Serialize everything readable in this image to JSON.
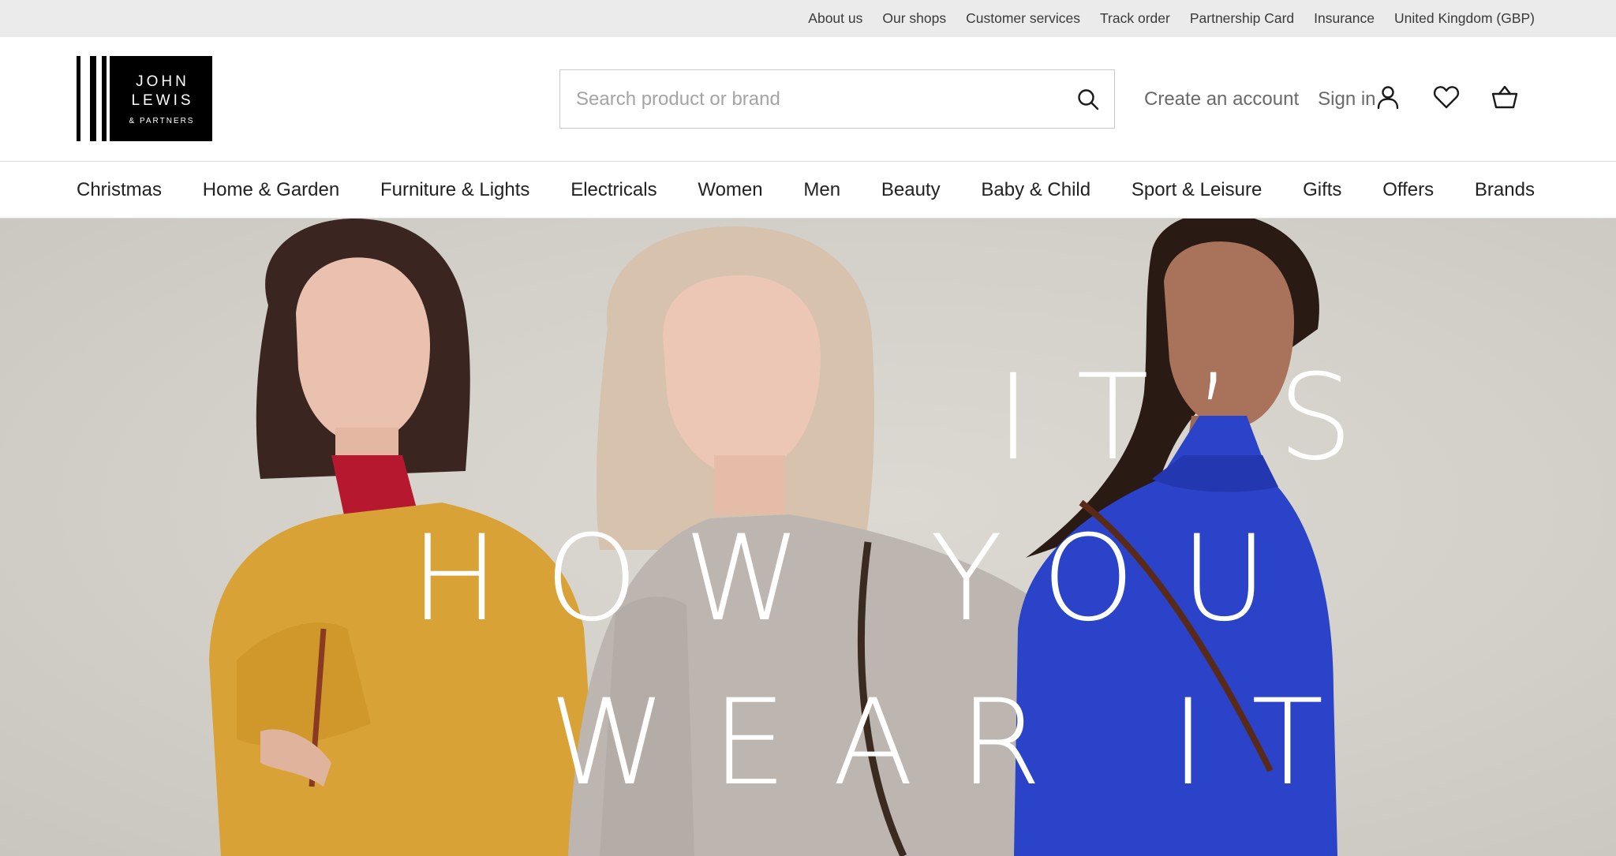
{
  "utility_nav": {
    "links": [
      "About us",
      "Our shops",
      "Customer services",
      "Track order",
      "Partnership Card",
      "Insurance",
      "United Kingdom (GBP)"
    ]
  },
  "logo": {
    "line1": "JOHN",
    "line2": "LEWIS",
    "line3": "& PARTNERS"
  },
  "search": {
    "placeholder": "Search product or brand",
    "icon": "search-icon"
  },
  "account": {
    "create_account": "Create an account",
    "sign_in": "Sign in",
    "icons": [
      "user-icon",
      "heart-icon",
      "basket-icon"
    ]
  },
  "main_nav": {
    "items": [
      "Christmas",
      "Home & Garden",
      "Furniture & Lights",
      "Electricals",
      "Women",
      "Men",
      "Beauty",
      "Baby & Child",
      "Sport & Leisure",
      "Gifts",
      "Offers",
      "Brands"
    ]
  },
  "hero": {
    "line1": "IT’S",
    "line2": "HOW YOU",
    "line3": "WEAR IT"
  },
  "colors": {
    "utility_bg": "#ebebeb",
    "hero_bg": "#d6d2cc",
    "mustard_sweater": "#d9a236",
    "grey_sweater": "#bdb6b0",
    "blue_sweater": "#2a43c8"
  }
}
